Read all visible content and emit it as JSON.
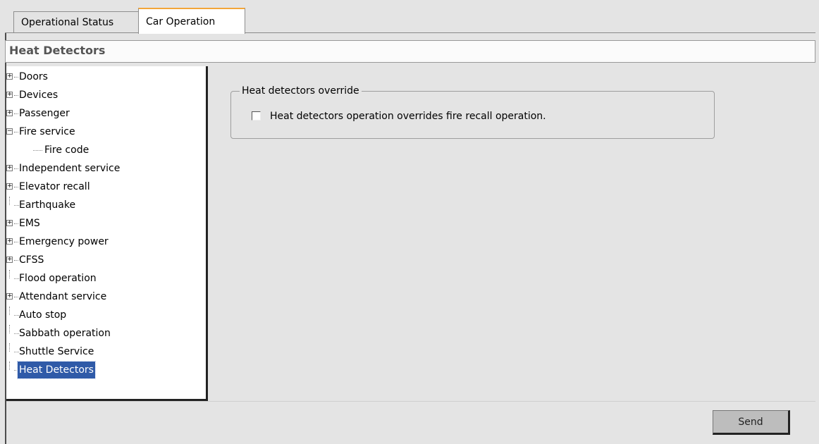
{
  "tabs": [
    {
      "label": "Operational Status",
      "active": false
    },
    {
      "label": "Car Operation",
      "active": true
    }
  ],
  "page_title": "Heat Detectors",
  "tree": [
    {
      "label": "Doors",
      "type": "collapsed"
    },
    {
      "label": "Devices",
      "type": "collapsed"
    },
    {
      "label": "Passenger",
      "type": "collapsed"
    },
    {
      "label": "Fire service",
      "type": "expanded"
    },
    {
      "label": "Fire code",
      "type": "child"
    },
    {
      "label": "Independent service",
      "type": "collapsed"
    },
    {
      "label": "Elevator recall",
      "type": "collapsed"
    },
    {
      "label": "Earthquake",
      "type": "leaf"
    },
    {
      "label": "EMS",
      "type": "collapsed"
    },
    {
      "label": "Emergency power",
      "type": "collapsed"
    },
    {
      "label": "CFSS",
      "type": "collapsed"
    },
    {
      "label": "Flood operation",
      "type": "leaf"
    },
    {
      "label": "Attendant service",
      "type": "collapsed"
    },
    {
      "label": "Auto stop",
      "type": "leaf"
    },
    {
      "label": "Sabbath operation",
      "type": "leaf"
    },
    {
      "label": "Shuttle Service",
      "type": "leaf"
    },
    {
      "label": "Heat Detectors",
      "type": "leaf",
      "selected": true
    }
  ],
  "group": {
    "title": "Heat detectors override",
    "checkbox_label": "Heat detectors operation overrides fire recall operation.",
    "checked": false
  },
  "buttons": {
    "send": "Send"
  },
  "colors": {
    "active_tab_accent": "#f3a63a",
    "selection": "#2f5aa8"
  }
}
